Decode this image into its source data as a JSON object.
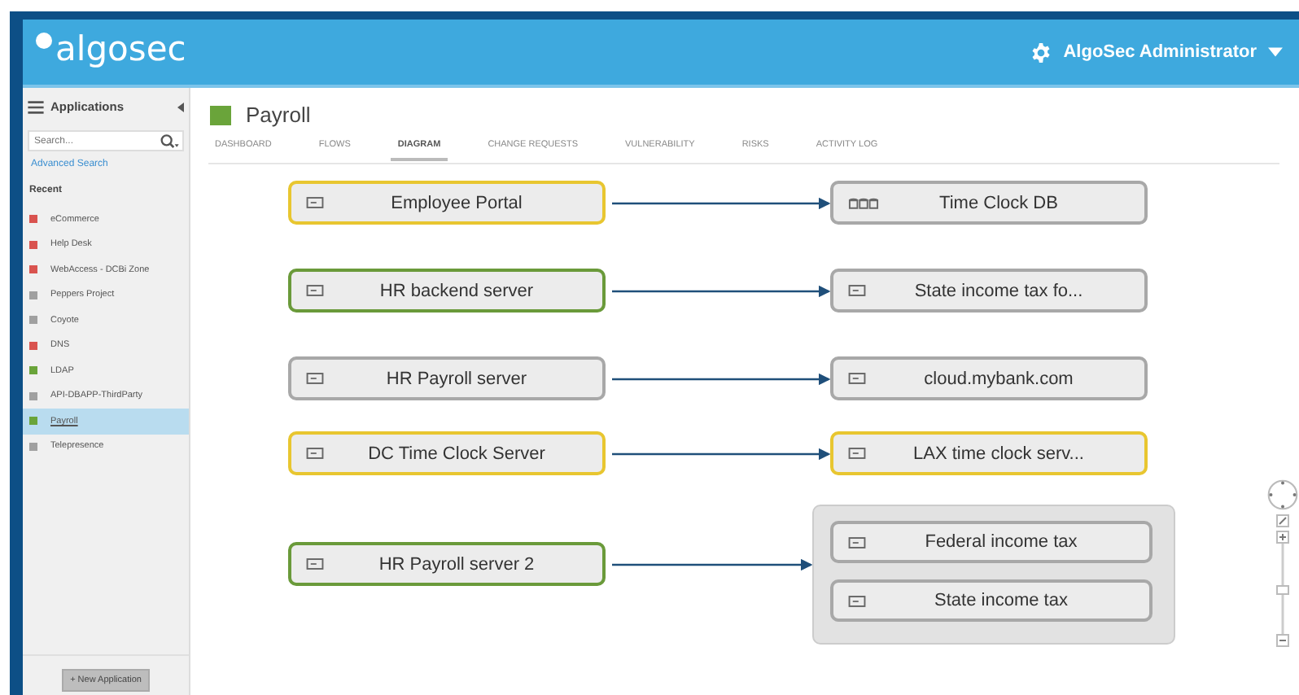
{
  "header": {
    "logo": "algosec",
    "user": "AlgoSec Administrator"
  },
  "sidebar": {
    "title": "Applications",
    "search": {
      "placeholder": "Search..."
    },
    "advanced_search": "Advanced Search",
    "section": "Recent",
    "items": [
      {
        "label": "eCommerce",
        "color": "#d9534f",
        "selected": false
      },
      {
        "label": "Help Desk",
        "color": "#d9534f",
        "selected": false
      },
      {
        "label": "WebAccess - DCBi Zone",
        "color": "#d9534f",
        "selected": false
      },
      {
        "label": "Peppers Project",
        "color": "#a0a0a0",
        "selected": false
      },
      {
        "label": "Coyote",
        "color": "#a0a0a0",
        "selected": false
      },
      {
        "label": "DNS",
        "color": "#d9534f",
        "selected": false
      },
      {
        "label": "LDAP",
        "color": "#6aa43a",
        "selected": false
      },
      {
        "label": "API-DBAPP-ThirdParty",
        "color": "#a0a0a0",
        "selected": false
      },
      {
        "label": "Payroll",
        "color": "#6aa43a",
        "selected": true
      },
      {
        "label": "Telepresence",
        "color": "#a0a0a0",
        "selected": false
      }
    ],
    "new_button": "+ New Application"
  },
  "page": {
    "title": "Payroll",
    "color": "#6aa43a",
    "tabs": [
      {
        "label": "DASHBOARD",
        "selected": false
      },
      {
        "label": "FLOWS",
        "selected": false
      },
      {
        "label": "DIAGRAM",
        "selected": true
      },
      {
        "label": "CHANGE REQUESTS",
        "selected": false
      },
      {
        "label": "VULNERABILITY",
        "selected": false
      },
      {
        "label": "RISKS",
        "selected": false
      },
      {
        "label": "ACTIVITY LOG",
        "selected": false
      }
    ]
  },
  "diagram": {
    "flows": [
      {
        "source": {
          "label": "Employee Portal",
          "kind": "server",
          "color": "#e8c630"
        },
        "targets": [
          {
            "label": "Time Clock DB",
            "kind": "database",
            "color": "#a8a8a8"
          }
        ]
      },
      {
        "source": {
          "label": "HR backend server",
          "kind": "server",
          "color": "#6a9a3a"
        },
        "targets": [
          {
            "label": "State income tax fo...",
            "kind": "server",
            "color": "#a8a8a8"
          }
        ]
      },
      {
        "source": {
          "label": "HR Payroll server",
          "kind": "server",
          "color": "#a8a8a8"
        },
        "targets": [
          {
            "label": "cloud.mybank.com",
            "kind": "server",
            "color": "#a8a8a8"
          }
        ]
      },
      {
        "source": {
          "label": "DC Time Clock Server",
          "kind": "server",
          "color": "#e8c630"
        },
        "targets": [
          {
            "label": "LAX time clock serv...",
            "kind": "server",
            "color": "#e8c630"
          }
        ]
      },
      {
        "source": {
          "label": "HR Payroll server 2",
          "kind": "server",
          "color": "#6a9a3a"
        },
        "targets": [
          {
            "label": "Federal income tax",
            "kind": "server",
            "color": "#a8a8a8"
          },
          {
            "label": "State income tax",
            "kind": "server",
            "color": "#a8a8a8"
          }
        ]
      }
    ]
  }
}
